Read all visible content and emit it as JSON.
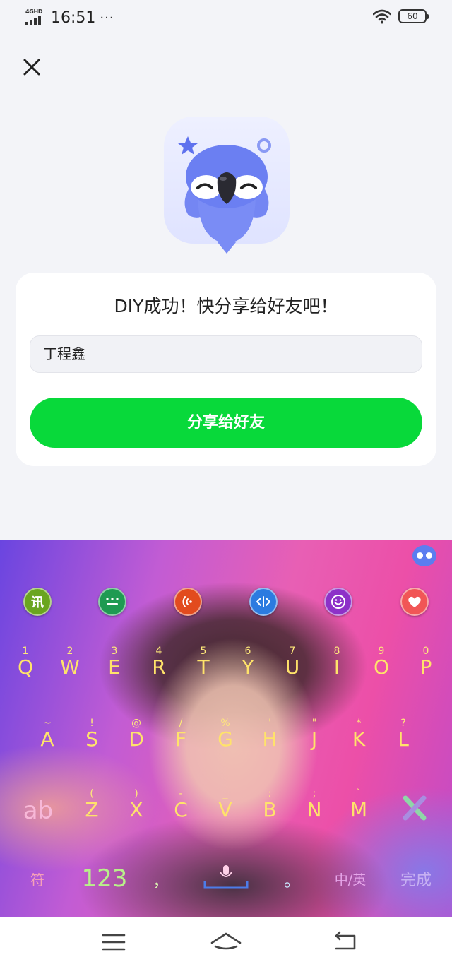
{
  "status_bar": {
    "network_label": "4GHD",
    "time": "16:51",
    "more_indicator": "···",
    "battery_level": "60"
  },
  "dialog": {
    "title": "DIY成功！快分享给好友吧！",
    "name_value": "丁程鑫",
    "share_button_label": "分享给好友"
  },
  "keyboard": {
    "toolbar": [
      {
        "icon": "xunfei-icon",
        "label": "讯",
        "color": "#6aa51f"
      },
      {
        "icon": "menu-icon",
        "label": "",
        "color": "#1f9a52"
      },
      {
        "icon": "voice-wave-icon",
        "label": "",
        "color": "#e24b1e"
      },
      {
        "icon": "code-cursor-icon",
        "label": "",
        "color": "#2b7be0"
      },
      {
        "icon": "emoji-icon",
        "label": "",
        "color": "#8d31c8"
      },
      {
        "icon": "heart-icon",
        "label": "",
        "color": "#f15656"
      }
    ],
    "row1": [
      {
        "hint": "1",
        "key": "Q"
      },
      {
        "hint": "2",
        "key": "W"
      },
      {
        "hint": "3",
        "key": "E"
      },
      {
        "hint": "4",
        "key": "R"
      },
      {
        "hint": "5",
        "key": "T"
      },
      {
        "hint": "6",
        "key": "Y"
      },
      {
        "hint": "7",
        "key": "U"
      },
      {
        "hint": "8",
        "key": "I"
      },
      {
        "hint": "9",
        "key": "O"
      },
      {
        "hint": "0",
        "key": "P"
      }
    ],
    "row2": [
      {
        "hint": "~",
        "key": "A"
      },
      {
        "hint": "!",
        "key": "S"
      },
      {
        "hint": "@",
        "key": "D"
      },
      {
        "hint": "/",
        "key": "F"
      },
      {
        "hint": "%",
        "key": "G"
      },
      {
        "hint": "'",
        "key": "H"
      },
      {
        "hint": "\"",
        "key": "J"
      },
      {
        "hint": "*",
        "key": "K"
      },
      {
        "hint": "?",
        "key": "L"
      }
    ],
    "row3": [
      {
        "hint": "(",
        "key": "Z"
      },
      {
        "hint": ")",
        "key": "X"
      },
      {
        "hint": "-",
        "key": "C"
      },
      {
        "hint": "_",
        "key": "V"
      },
      {
        "hint": ":",
        "key": "B"
      },
      {
        "hint": ";",
        "key": "N"
      },
      {
        "hint": "`",
        "key": "M"
      }
    ],
    "shift_label": "ab",
    "symbols_label": "符",
    "numbers_label": "123",
    "comma_label": "，",
    "period_label": "。",
    "lang_switch_label": "中/英",
    "done_label": "完成",
    "colors": {
      "key_text": "#ffe36a",
      "hint_text": "#ffe97a"
    }
  },
  "nav_bar": {
    "buttons": [
      "menu-icon",
      "home-icon",
      "back-icon"
    ]
  }
}
